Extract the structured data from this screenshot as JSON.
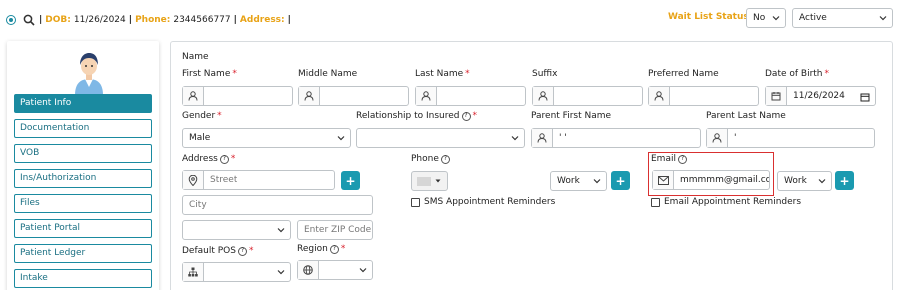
{
  "header": {
    "dob_label": "DOB:",
    "dob_value": "11/26/2024",
    "phone_label": "Phone:",
    "phone_value": "2344566777",
    "address_label": "Address:",
    "separator": "|",
    "waitlist_label": "Wait List Status:",
    "waitlist_value": "No",
    "status_value": "Active"
  },
  "sidebar": {
    "items": [
      {
        "label": "Patient Info",
        "active": true
      },
      {
        "label": "Documentation",
        "active": false
      },
      {
        "label": "VOB",
        "active": false
      },
      {
        "label": "Ins/Authorization",
        "active": false
      },
      {
        "label": "Files",
        "active": false
      },
      {
        "label": "Patient Portal",
        "active": false
      },
      {
        "label": "Patient Ledger",
        "active": false
      },
      {
        "label": "Intake",
        "active": false
      }
    ]
  },
  "form": {
    "section_title": "Name",
    "first_name_label": "First Name",
    "middle_name_label": "Middle Name",
    "last_name_label": "Last Name",
    "suffix_label": "Suffix",
    "preferred_name_label": "Preferred Name",
    "dob_label": "Date of Birth",
    "dob_value": "11/26/2024",
    "gender_label": "Gender",
    "gender_value": "Male",
    "relationship_label": "Relationship to Insured",
    "parent_first_label": "Parent First Name",
    "parent_first_value": "' '",
    "parent_last_label": "Parent Last Name",
    "parent_last_value": "'",
    "address_label": "Address",
    "street_placeholder": "Street",
    "city_placeholder": "City",
    "zip_placeholder": "Enter ZIP Code f",
    "phone_label": "Phone",
    "phone_type": "Work",
    "sms_label": "SMS Appointment Reminders",
    "email_label": "Email",
    "email_value": "mmmmm@gmail.co",
    "email_type": "Work",
    "email_reminder_label": "Email Appointment Reminders",
    "pos_label": "Default POS",
    "region_label": "Region",
    "required_mark": "*",
    "plus": "+"
  },
  "colors": {
    "accent": "#1a8aa0",
    "orange": "#e8a317",
    "required": "#d9232e",
    "highlight": "#d93030"
  }
}
